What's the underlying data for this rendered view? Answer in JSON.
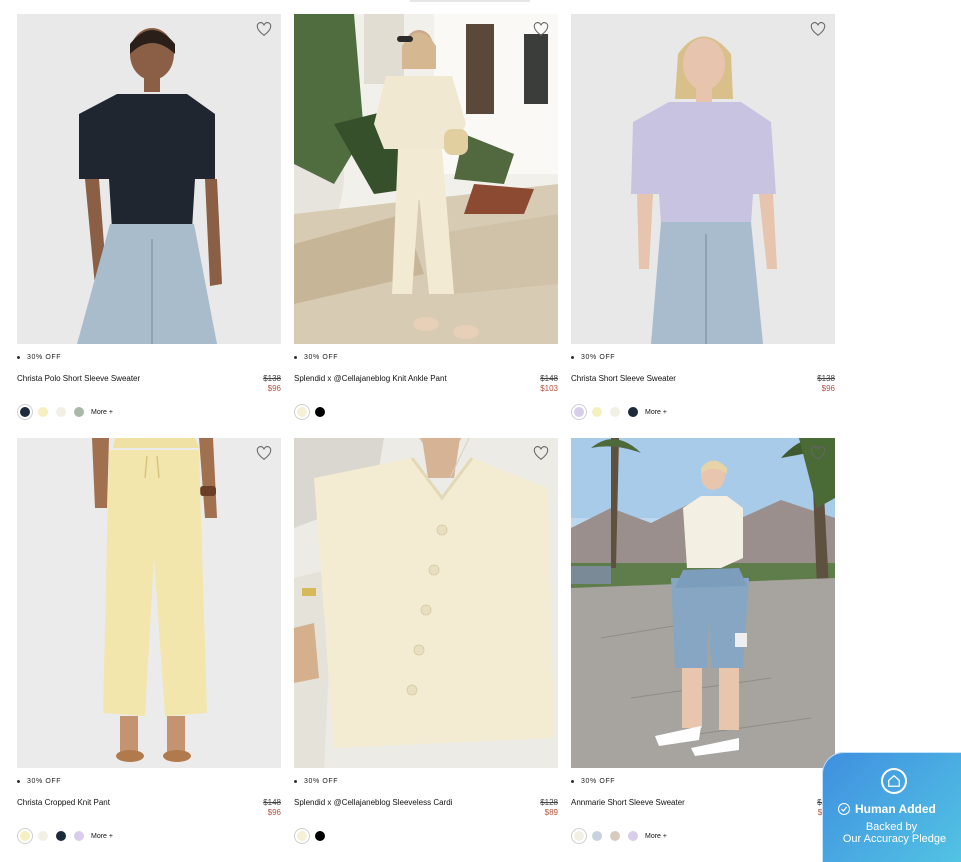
{
  "products": [
    {
      "badge": "30% OFF",
      "name": "Christa Polo Short Sleeve Sweater",
      "price_original": "$138",
      "price_sale": "$96",
      "swatches": [
        "#1c2a3c",
        "#f6efbf",
        "#f1f0e4",
        "#a7b9a8"
      ],
      "more": "More +"
    },
    {
      "badge": "30% OFF",
      "name": "Splendid x @Cellajaneblog Knit Ankle Pant",
      "price_original": "$148",
      "price_sale": "$103",
      "swatches": [
        "#f5f0d8",
        "#000000"
      ],
      "more": ""
    },
    {
      "badge": "30% OFF",
      "name": "Christa Short Sleeve Sweater",
      "price_original": "$138",
      "price_sale": "$96",
      "swatches": [
        "#d9cdec",
        "#f6efbf",
        "#f1f0e4",
        "#1c2a3c"
      ],
      "more": "More +"
    },
    {
      "badge": "30% OFF",
      "name": "Christa Cropped Knit Pant",
      "price_original": "$148",
      "price_sale": "$96",
      "swatches": [
        "#f6efbf",
        "#f1f0e4",
        "#1c2a3c",
        "#d9cdec"
      ],
      "more": "More +"
    },
    {
      "badge": "30% OFF",
      "name": "Splendid x @Cellajaneblog Sleeveless Cardi",
      "price_original": "$128",
      "price_sale": "$89",
      "swatches": [
        "#f5f0d8",
        "#000000"
      ],
      "more": ""
    },
    {
      "badge": "30% OFF",
      "name": "Annmarie Short Sleeve Sweater",
      "price_original": "$168",
      "price_sale": "$118",
      "swatches": [
        "#f1f0e4",
        "#c9d3e0",
        "#d6cbbd",
        "#d9cdec"
      ],
      "more": "More +"
    }
  ],
  "human_added": {
    "title": "Human Added",
    "line1": "Backed by",
    "line2": "Our Accuracy Pledge",
    "icon": "home-circle-icon",
    "colors": {
      "from": "#3f8fe0",
      "to": "#52c3e3"
    }
  },
  "colors": {
    "sale_price": "#b5523b",
    "heart": "#666666"
  }
}
